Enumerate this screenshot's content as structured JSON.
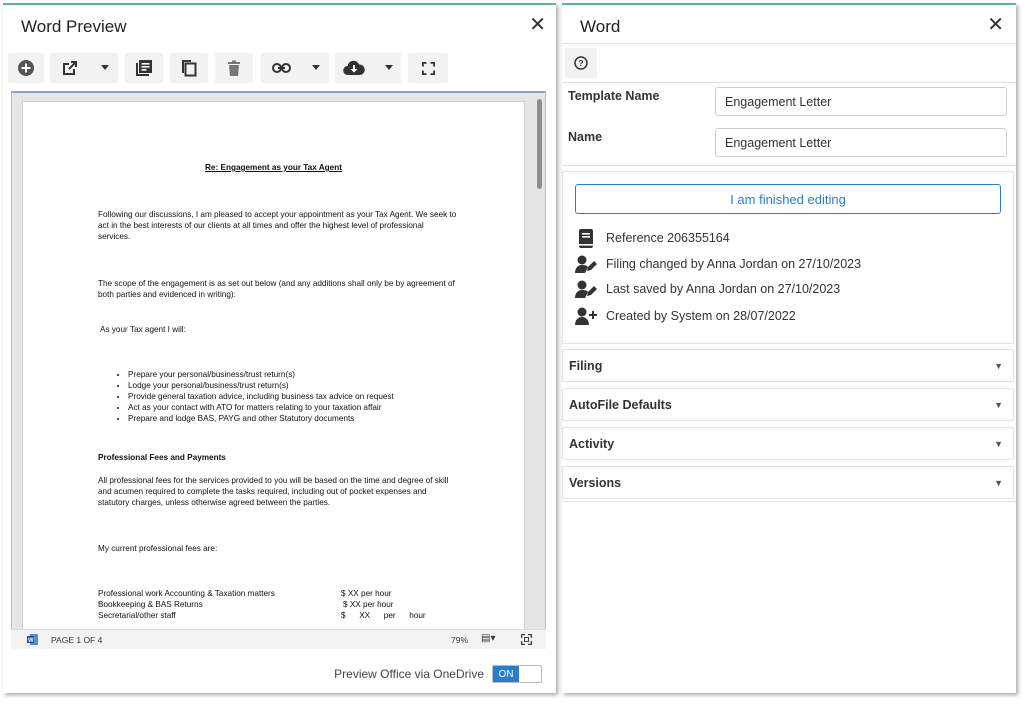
{
  "preview_panel": {
    "title": "Word Preview",
    "toolbar": {
      "add": "add-circle-icon",
      "open_external": "external-link-icon",
      "document_list": "document-list-icon",
      "copy": "copy-icon",
      "delete": "trash-icon",
      "link": "link-icon",
      "download": "cloud-download-icon",
      "fullscreen": "fullscreen-icon"
    },
    "document": {
      "heading": "Re: Engagement as your Tax Agent",
      "para1": "Following our discussions, I am pleased to accept your appointment as your Tax Agent.  We seek to act in the best interests of our clients at all times and offer the highest level of professional services.",
      "para2": "The scope of the engagement is as set out below (and any additions shall only be by agreement of both parties and evidenced in writing):",
      "para3": "As your Tax agent I will:",
      "bullets": [
        "Prepare your personal/business/trust return(s)",
        "Lodge your personal/business/trust return(s)",
        "Provide general taxation advice, including business tax advice on request",
        "Act as your contact with ATO for matters relating to your taxation affair",
        "Prepare and lodge BAS, PAYG and other Statutory documents"
      ],
      "subheading": "Professional Fees and Payments",
      "para4": "All professional fees for the services provided to you will be based on the time and degree of skill and acumen required to complete the tasks required, including out of pocket expenses and statutory charges, unless otherwise agreed between the parties.",
      "para5": "My current professional fees are:",
      "fees": [
        {
          "label": "Professional work Accounting & Taxation matters",
          "value": "$ XX per hour"
        },
        {
          "label": "Bookkeeping & BAS Returns",
          "value": "$ XX per hour"
        },
        {
          "label": "Secretarial/other staff",
          "value": "$      XX      per      hour"
        }
      ]
    },
    "status": {
      "page": "PAGE 1 OF 4",
      "zoom": "79%"
    },
    "toggle": {
      "label": "Preview Office via OneDrive",
      "state": "ON",
      "accent": "#2a7dc8"
    }
  },
  "details_panel": {
    "title": "Word",
    "template_name_label": "Template Name",
    "template_name_value": "Engagement Letter",
    "name_label": "Name",
    "name_value": "Engagement Letter",
    "finished_button": "I am finished editing",
    "info": [
      {
        "icon": "book-icon",
        "text": "Reference 206355164"
      },
      {
        "icon": "user-edit-icon",
        "text": "Filing changed by Anna Jordan on 27/10/2023"
      },
      {
        "icon": "user-edit-icon",
        "text": "Last saved by Anna Jordan on 27/10/2023"
      },
      {
        "icon": "user-plus-icon",
        "text": "Created by System on 28/07/2022"
      }
    ],
    "sections": [
      "Filing",
      "AutoFile Defaults",
      "Activity",
      "Versions"
    ]
  }
}
